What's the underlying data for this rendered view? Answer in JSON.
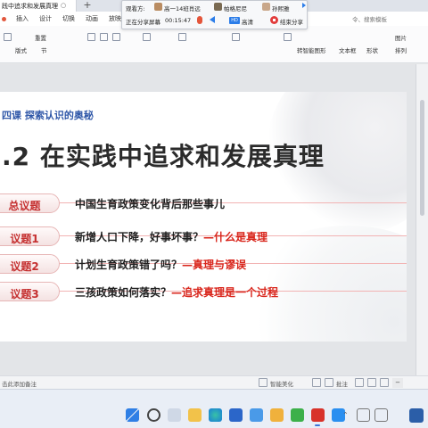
{
  "window": {
    "doc_tab": "践中追求和发展真理",
    "tab_close": "○ ×",
    "tab_new": "+"
  },
  "ribbon": {
    "menu": [
      "插入",
      "设计",
      "切换",
      "动画",
      "放映"
    ],
    "menu_right": "令、搜索模板",
    "tools": {
      "new_slide": "重置",
      "layout": "版式",
      "section": "节",
      "chart_label": "转智能图形",
      "text_box": "文本框",
      "shape": "形状",
      "picture": "图片",
      "arrange": "排列"
    }
  },
  "share_bar": {
    "viewers_label": "观看方:",
    "viewers": [
      "高一14班肖远",
      "帕格尼尼",
      "孙熙雅"
    ],
    "sharing_label": "正在分享屏幕",
    "timer": "00:15:47",
    "hd_label": "HD",
    "hd": "高清",
    "stop": "结束分享"
  },
  "slide": {
    "subtitle": "四课  探索认识的奥秘",
    "title": ".2   在实践中追求和发展真理",
    "topics": [
      {
        "badge": "总议题",
        "text": "中国生育政策变化背后那些事儿",
        "highlight": ""
      },
      {
        "badge": "议题1",
        "text": "新增人口下降，好事坏事？",
        "highlight": "—什么是真理"
      },
      {
        "badge": "议题2",
        "text": "计划生育政策错了吗？",
        "highlight": "—真理与谬误"
      },
      {
        "badge": "议题3",
        "text": "三孩政策如何落实？",
        "highlight": "—追求真理是一个过程"
      }
    ]
  },
  "status_bar": {
    "notes": "击此添加备注",
    "smart_beautify": "智能美化",
    "notes_btn": "批注",
    "zoom_out": "−"
  },
  "colors": {
    "accent_red": "#d9261c",
    "accent_blue": "#2f57a8",
    "badge_border": "#e7b6b6"
  }
}
